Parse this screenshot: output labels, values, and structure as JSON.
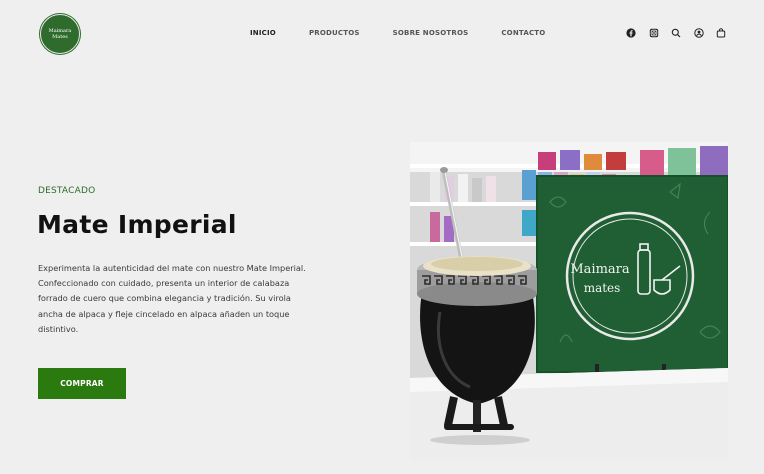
{
  "brand": {
    "logo_line1": "Maimara",
    "logo_line2": "Mates"
  },
  "nav": {
    "items": [
      {
        "label": "INICIO"
      },
      {
        "label": "PRODUCTOS"
      },
      {
        "label": "SOBRE NOSOTROS"
      },
      {
        "label": "CONTACTO"
      }
    ]
  },
  "header_icons": [
    "facebook-icon",
    "instagram-icon",
    "search-icon",
    "account-icon",
    "cart-icon"
  ],
  "hero": {
    "eyebrow": "DESTACADO",
    "title": "Mate Imperial",
    "description": "Experimenta la autenticidad del mate con nuestro Mate Imperial. Confeccionado con cuidado, presenta un interior de calabaza forrado de cuero que combina elegancia y tradición. Su virola ancha de alpaca y fleje cincelado en alpaca añaden un toque distintivo.",
    "button_label": "COMPRAR",
    "image_sign_line1": "Maimara",
    "image_sign_line2": "mates"
  },
  "colors": {
    "accent": "#2a7a10",
    "brand_green": "#2f6b2c",
    "background": "#efefef"
  }
}
